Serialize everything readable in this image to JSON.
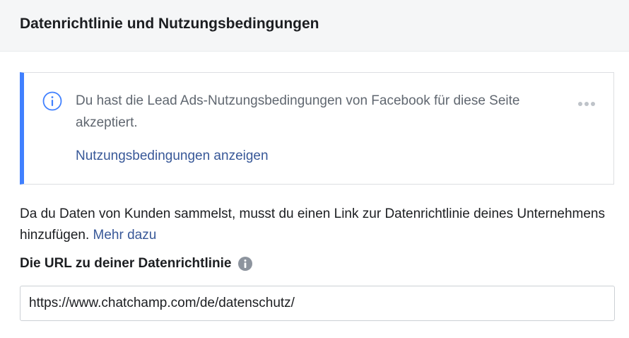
{
  "header": {
    "title": "Datenrichtlinie und Nutzungsbedingungen"
  },
  "notice": {
    "icon": "info-circle-icon",
    "text": "Du hast die Lead Ads-Nutzungsbedingungen von Facebook für diese Seite akzeptiert.",
    "link_label": "Nutzungsbedingungen anzeigen",
    "more_icon": "more-options-icon",
    "accent_color": "#4080ff"
  },
  "description": {
    "text": "Da du Daten von Kunden sammelst, musst du einen Link zur Datenrichtlinie deines Unternehmens hinzufügen.",
    "link_label": "Mehr dazu"
  },
  "privacy_url": {
    "label": "Die URL zu deiner Datenrichtlinie",
    "info_icon": "info-icon",
    "value": "https://www.chatchamp.com/de/datenschutz/"
  },
  "colors": {
    "link": "#385898",
    "header_bg": "#f5f6f7",
    "muted_text": "#606770"
  }
}
